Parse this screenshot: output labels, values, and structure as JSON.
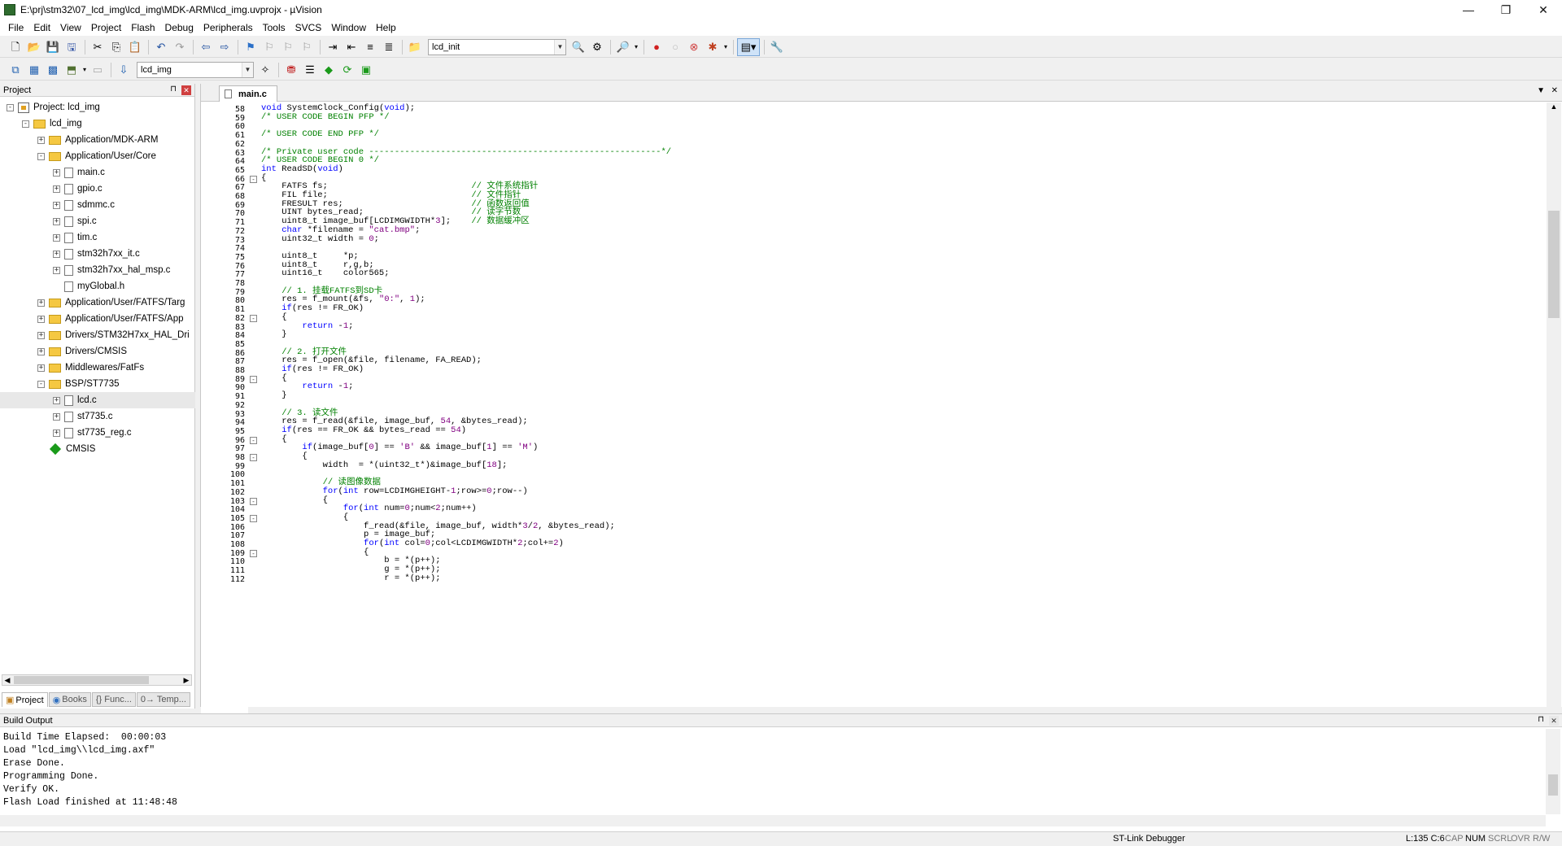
{
  "window": {
    "title": "E:\\prj\\stm32\\07_lcd_img\\lcd_img\\MDK-ARM\\lcd_img.uvprojx - µVision",
    "min": "—",
    "max": "❐",
    "close": "✕"
  },
  "menu": [
    "File",
    "Edit",
    "View",
    "Project",
    "Flash",
    "Debug",
    "Peripherals",
    "Tools",
    "SVCS",
    "Window",
    "Help"
  ],
  "toolbar1": {
    "find_combo": "lcd_init"
  },
  "toolbar2": {
    "target_combo": "lcd_img"
  },
  "project_pane": {
    "title": "Project",
    "tree": [
      {
        "label": "Project: lcd_img",
        "kind": "project",
        "level": 0,
        "exp": "-"
      },
      {
        "label": "lcd_img",
        "kind": "folder",
        "level": 1,
        "exp": "-"
      },
      {
        "label": "Application/MDK-ARM",
        "kind": "folder",
        "level": 2,
        "exp": "+"
      },
      {
        "label": "Application/User/Core",
        "kind": "folder",
        "level": 2,
        "exp": "-"
      },
      {
        "label": "main.c",
        "kind": "file",
        "level": 3,
        "exp": "+"
      },
      {
        "label": "gpio.c",
        "kind": "file",
        "level": 3,
        "exp": "+"
      },
      {
        "label": "sdmmc.c",
        "kind": "file",
        "level": 3,
        "exp": "+"
      },
      {
        "label": "spi.c",
        "kind": "file",
        "level": 3,
        "exp": "+"
      },
      {
        "label": "tim.c",
        "kind": "file",
        "level": 3,
        "exp": "+"
      },
      {
        "label": "stm32h7xx_it.c",
        "kind": "file",
        "level": 3,
        "exp": "+"
      },
      {
        "label": "stm32h7xx_hal_msp.c",
        "kind": "file",
        "level": 3,
        "exp": "+"
      },
      {
        "label": "myGlobal.h",
        "kind": "file",
        "level": 3,
        "exp": ""
      },
      {
        "label": "Application/User/FATFS/Targ",
        "kind": "folder",
        "level": 2,
        "exp": "+"
      },
      {
        "label": "Application/User/FATFS/App",
        "kind": "folder",
        "level": 2,
        "exp": "+"
      },
      {
        "label": "Drivers/STM32H7xx_HAL_Dri",
        "kind": "folder",
        "level": 2,
        "exp": "+"
      },
      {
        "label": "Drivers/CMSIS",
        "kind": "folder",
        "level": 2,
        "exp": "+"
      },
      {
        "label": "Middlewares/FatFs",
        "kind": "folder",
        "level": 2,
        "exp": "+"
      },
      {
        "label": "BSP/ST7735",
        "kind": "folder",
        "level": 2,
        "exp": "-"
      },
      {
        "label": "lcd.c",
        "kind": "file",
        "level": 3,
        "exp": "+",
        "selected": true
      },
      {
        "label": "st7735.c",
        "kind": "file",
        "level": 3,
        "exp": "+"
      },
      {
        "label": "st7735_reg.c",
        "kind": "file",
        "level": 3,
        "exp": "+"
      },
      {
        "label": "CMSIS",
        "kind": "diamond",
        "level": 2,
        "exp": ""
      }
    ],
    "tabs": [
      "Project",
      "Books",
      "{} Func...",
      "0→ Temp..."
    ]
  },
  "editor": {
    "tab": "main.c",
    "first_line": 58,
    "lines": [
      [
        [
          "void SystemClock_Config(void);",
          "kw:void|"
        ]
      ],
      [
        [
          "/* USER CODE BEGIN PFP */",
          "cm"
        ]
      ],
      [
        [
          "",
          ""
        ]
      ],
      [
        [
          "/* USER CODE END PFP */",
          "cm"
        ]
      ],
      [
        [
          "",
          ""
        ]
      ],
      [
        [
          "/* Private user code ---------------------------------------------------------*/",
          "cm"
        ]
      ],
      [
        [
          "/* USER CODE BEGIN 0 */",
          "cm"
        ]
      ],
      [
        [
          "int",
          "kw"
        ],
        [
          " ReadSD(",
          ""
        ],
        [
          "void",
          "kw"
        ],
        [
          ")",
          ""
        ]
      ],
      [
        [
          "{",
          ""
        ]
      ],
      [
        [
          "    FATFS fs;                            ",
          ""
        ],
        [
          "// 文件系统指针",
          "cm"
        ]
      ],
      [
        [
          "    FIL file;                            ",
          ""
        ],
        [
          "// 文件指针",
          "cm"
        ]
      ],
      [
        [
          "    FRESULT res;                         ",
          ""
        ],
        [
          "// 函数返回值",
          "cm"
        ]
      ],
      [
        [
          "    UINT bytes_read;                     ",
          ""
        ],
        [
          "// 读字节数",
          "cm"
        ]
      ],
      [
        [
          "    uint8_t image_buf[LCDIMGWIDTH*",
          ""
        ],
        [
          "3",
          ""
        ],
        [
          "];    ",
          ""
        ],
        [
          "// 数据缓冲区",
          "cm"
        ]
      ],
      [
        [
          "    ",
          ""
        ],
        [
          "char",
          "kw"
        ],
        [
          " *filename = ",
          ""
        ],
        [
          "\"cat.bmp\"",
          "st"
        ],
        [
          ";",
          ""
        ]
      ],
      [
        [
          "    uint32_t width = ",
          ""
        ],
        [
          "0",
          ""
        ],
        [
          ";",
          ""
        ]
      ],
      [
        [
          "",
          ""
        ]
      ],
      [
        [
          "    uint8_t     *p;",
          ""
        ]
      ],
      [
        [
          "    uint8_t     r,g,b;",
          ""
        ]
      ],
      [
        [
          "    uint16_t    color565;",
          ""
        ]
      ],
      [
        [
          "",
          ""
        ]
      ],
      [
        [
          "    // 1. 挂载FATFS到SD卡",
          "cm"
        ]
      ],
      [
        [
          "    res = f_mount(&fs, ",
          ""
        ],
        [
          "\"0:\"",
          "st"
        ],
        [
          ", ",
          ""
        ],
        [
          "1",
          ""
        ],
        [
          ");",
          ""
        ]
      ],
      [
        [
          "    ",
          ""
        ],
        [
          "if",
          "kw"
        ],
        [
          "(res != FR_OK)",
          ""
        ]
      ],
      [
        [
          "    {",
          ""
        ]
      ],
      [
        [
          "        ",
          ""
        ],
        [
          "return",
          "kw"
        ],
        [
          " -",
          ""
        ],
        [
          "1",
          ""
        ],
        [
          ";",
          ""
        ]
      ],
      [
        [
          "    }",
          ""
        ]
      ],
      [
        [
          "",
          ""
        ]
      ],
      [
        [
          "    // 2. 打开文件",
          "cm"
        ]
      ],
      [
        [
          "    res = f_open(&file, filename, FA_READ);",
          ""
        ]
      ],
      [
        [
          "    ",
          ""
        ],
        [
          "if",
          "kw"
        ],
        [
          "(res != FR_OK)",
          ""
        ]
      ],
      [
        [
          "    {",
          ""
        ]
      ],
      [
        [
          "        ",
          ""
        ],
        [
          "return",
          "kw"
        ],
        [
          " -",
          ""
        ],
        [
          "1",
          ""
        ],
        [
          ";",
          ""
        ]
      ],
      [
        [
          "    }",
          ""
        ]
      ],
      [
        [
          "",
          ""
        ]
      ],
      [
        [
          "    // 3. 读文件",
          "cm"
        ]
      ],
      [
        [
          "    res = f_read(&file, image_buf, ",
          ""
        ],
        [
          "54",
          ""
        ],
        [
          ", &bytes_read);",
          ""
        ]
      ],
      [
        [
          "    ",
          ""
        ],
        [
          "if",
          "kw"
        ],
        [
          "(res == FR_OK && bytes_read == ",
          ""
        ],
        [
          "54",
          ""
        ],
        [
          ")",
          ""
        ]
      ],
      [
        [
          "    {",
          ""
        ]
      ],
      [
        [
          "        ",
          ""
        ],
        [
          "if",
          "kw"
        ],
        [
          "(image_buf[",
          ""
        ],
        [
          "0",
          ""
        ],
        [
          "] == ",
          ""
        ],
        [
          "'B'",
          "st"
        ],
        [
          " && image_buf[",
          ""
        ],
        [
          "1",
          ""
        ],
        [
          "] == ",
          ""
        ],
        [
          "'M'",
          "st"
        ],
        [
          ")",
          ""
        ]
      ],
      [
        [
          "        {",
          ""
        ]
      ],
      [
        [
          "            width  = *(uint32_t*)&image_buf[",
          ""
        ],
        [
          "18",
          ""
        ],
        [
          "];",
          ""
        ]
      ],
      [
        [
          "",
          ""
        ]
      ],
      [
        [
          "            // 读图像数据",
          "cm"
        ]
      ],
      [
        [
          "            ",
          ""
        ],
        [
          "for",
          "kw"
        ],
        [
          "(",
          ""
        ],
        [
          "int",
          "kw"
        ],
        [
          " row=LCDIMGHEIGHT-",
          ""
        ],
        [
          "1",
          ""
        ],
        [
          ";row>=",
          ""
        ],
        [
          "0",
          ""
        ],
        [
          ";row--)",
          ""
        ]
      ],
      [
        [
          "            {",
          ""
        ]
      ],
      [
        [
          "                ",
          ""
        ],
        [
          "for",
          "kw"
        ],
        [
          "(",
          ""
        ],
        [
          "int",
          "kw"
        ],
        [
          " num=",
          ""
        ],
        [
          "0",
          ""
        ],
        [
          ";num<",
          ""
        ],
        [
          "2",
          ""
        ],
        [
          ";num++)",
          ""
        ]
      ],
      [
        [
          "                {",
          ""
        ]
      ],
      [
        [
          "                    f_read(&file, image_buf, width*",
          ""
        ],
        [
          "3",
          ""
        ],
        [
          "/",
          ""
        ],
        [
          "2",
          ""
        ],
        [
          ", &bytes_read);",
          ""
        ]
      ],
      [
        [
          "                    p = image_buf;",
          ""
        ]
      ],
      [
        [
          "                    ",
          ""
        ],
        [
          "for",
          "kw"
        ],
        [
          "(",
          ""
        ],
        [
          "int",
          "kw"
        ],
        [
          " col=",
          ""
        ],
        [
          "0",
          ""
        ],
        [
          ";col<LCDIMGWIDTH*",
          ""
        ],
        [
          "2",
          ""
        ],
        [
          ";col+=",
          ""
        ],
        [
          "2",
          ""
        ],
        [
          ")",
          ""
        ]
      ],
      [
        [
          "                    {",
          ""
        ]
      ],
      [
        [
          "                        b = *(p++);",
          ""
        ]
      ],
      [
        [
          "                        g = *(p++);",
          ""
        ]
      ],
      [
        [
          "                        r = *(p++);",
          ""
        ]
      ]
    ],
    "fold_lines": [
      66,
      82,
      89,
      96,
      98,
      103,
      105,
      109
    ]
  },
  "build_output": {
    "title": "Build Output",
    "lines": [
      "Build Time Elapsed:  00:00:03",
      "Load \"lcd_img\\\\lcd_img.axf\"",
      "Erase Done.",
      "Programming Done.",
      "Verify OK.",
      "Flash Load finished at 11:48:48"
    ]
  },
  "status": {
    "debugger": "ST-Link Debugger",
    "pos": "L:135 C:6",
    "caps": "CAP",
    "num": "NUM",
    "scrl": "SCRL",
    "ovr": "OVR",
    "rw": "R/W"
  }
}
